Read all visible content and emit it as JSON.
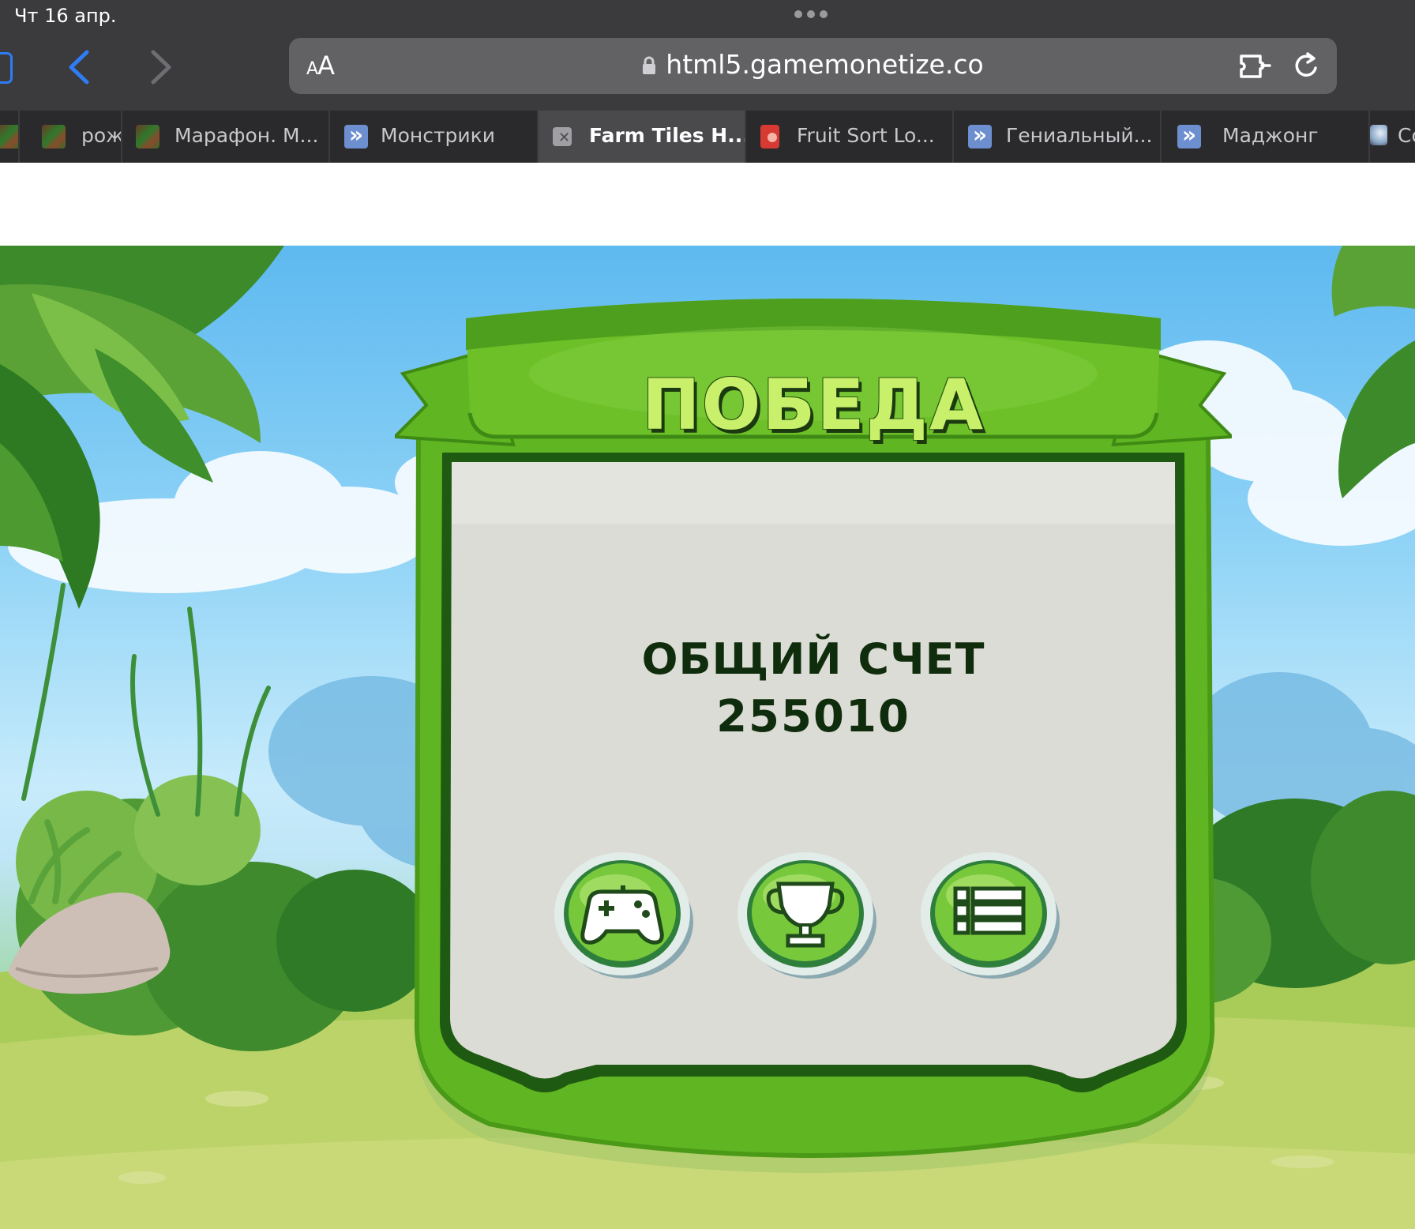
{
  "status_bar": {
    "time": "Чт 16 апр."
  },
  "address_bar": {
    "text_size_label_small": "A",
    "text_size_label_large": "A",
    "url": "html5.gamemonetize.co"
  },
  "tabs": [
    {
      "label": "",
      "favicon": "farm-favicon",
      "active": false
    },
    {
      "label": "рож",
      "favicon": "farm-favicon",
      "active": false
    },
    {
      "label": "Марафон. М...",
      "favicon": "farm-favicon",
      "active": false
    },
    {
      "label": "Монстрики",
      "favicon": "forward-arrows-favicon",
      "active": false
    },
    {
      "label": "Farm Tiles H...",
      "favicon": "close-icon",
      "active": true
    },
    {
      "label": "Fruit Sort Lo...",
      "favicon": "fruit-favicon",
      "active": false
    },
    {
      "label": "Гениальный...",
      "favicon": "forward-arrows-favicon",
      "active": false
    },
    {
      "label": "Маджонг",
      "favicon": "forward-arrows-favicon",
      "active": false
    },
    {
      "label": "Co",
      "favicon": "round-favicon",
      "active": false
    }
  ],
  "game": {
    "title": "ПОБЕДА",
    "score_label": "ОБЩИЙ СЧЕТ",
    "score_value": "255010",
    "buttons": [
      {
        "name": "play-button",
        "icon": "gamepad-icon"
      },
      {
        "name": "trophy-button",
        "icon": "trophy-icon"
      },
      {
        "name": "menu-button",
        "icon": "list-icon"
      }
    ]
  },
  "colors": {
    "chrome_bg": "#3b3b3d",
    "link_blue": "#2f7cf6",
    "panel_green": "#5fb522",
    "panel_inner": "#dcdcd6",
    "title_green": "#c8f06a",
    "score_text": "#0f2d0c"
  }
}
